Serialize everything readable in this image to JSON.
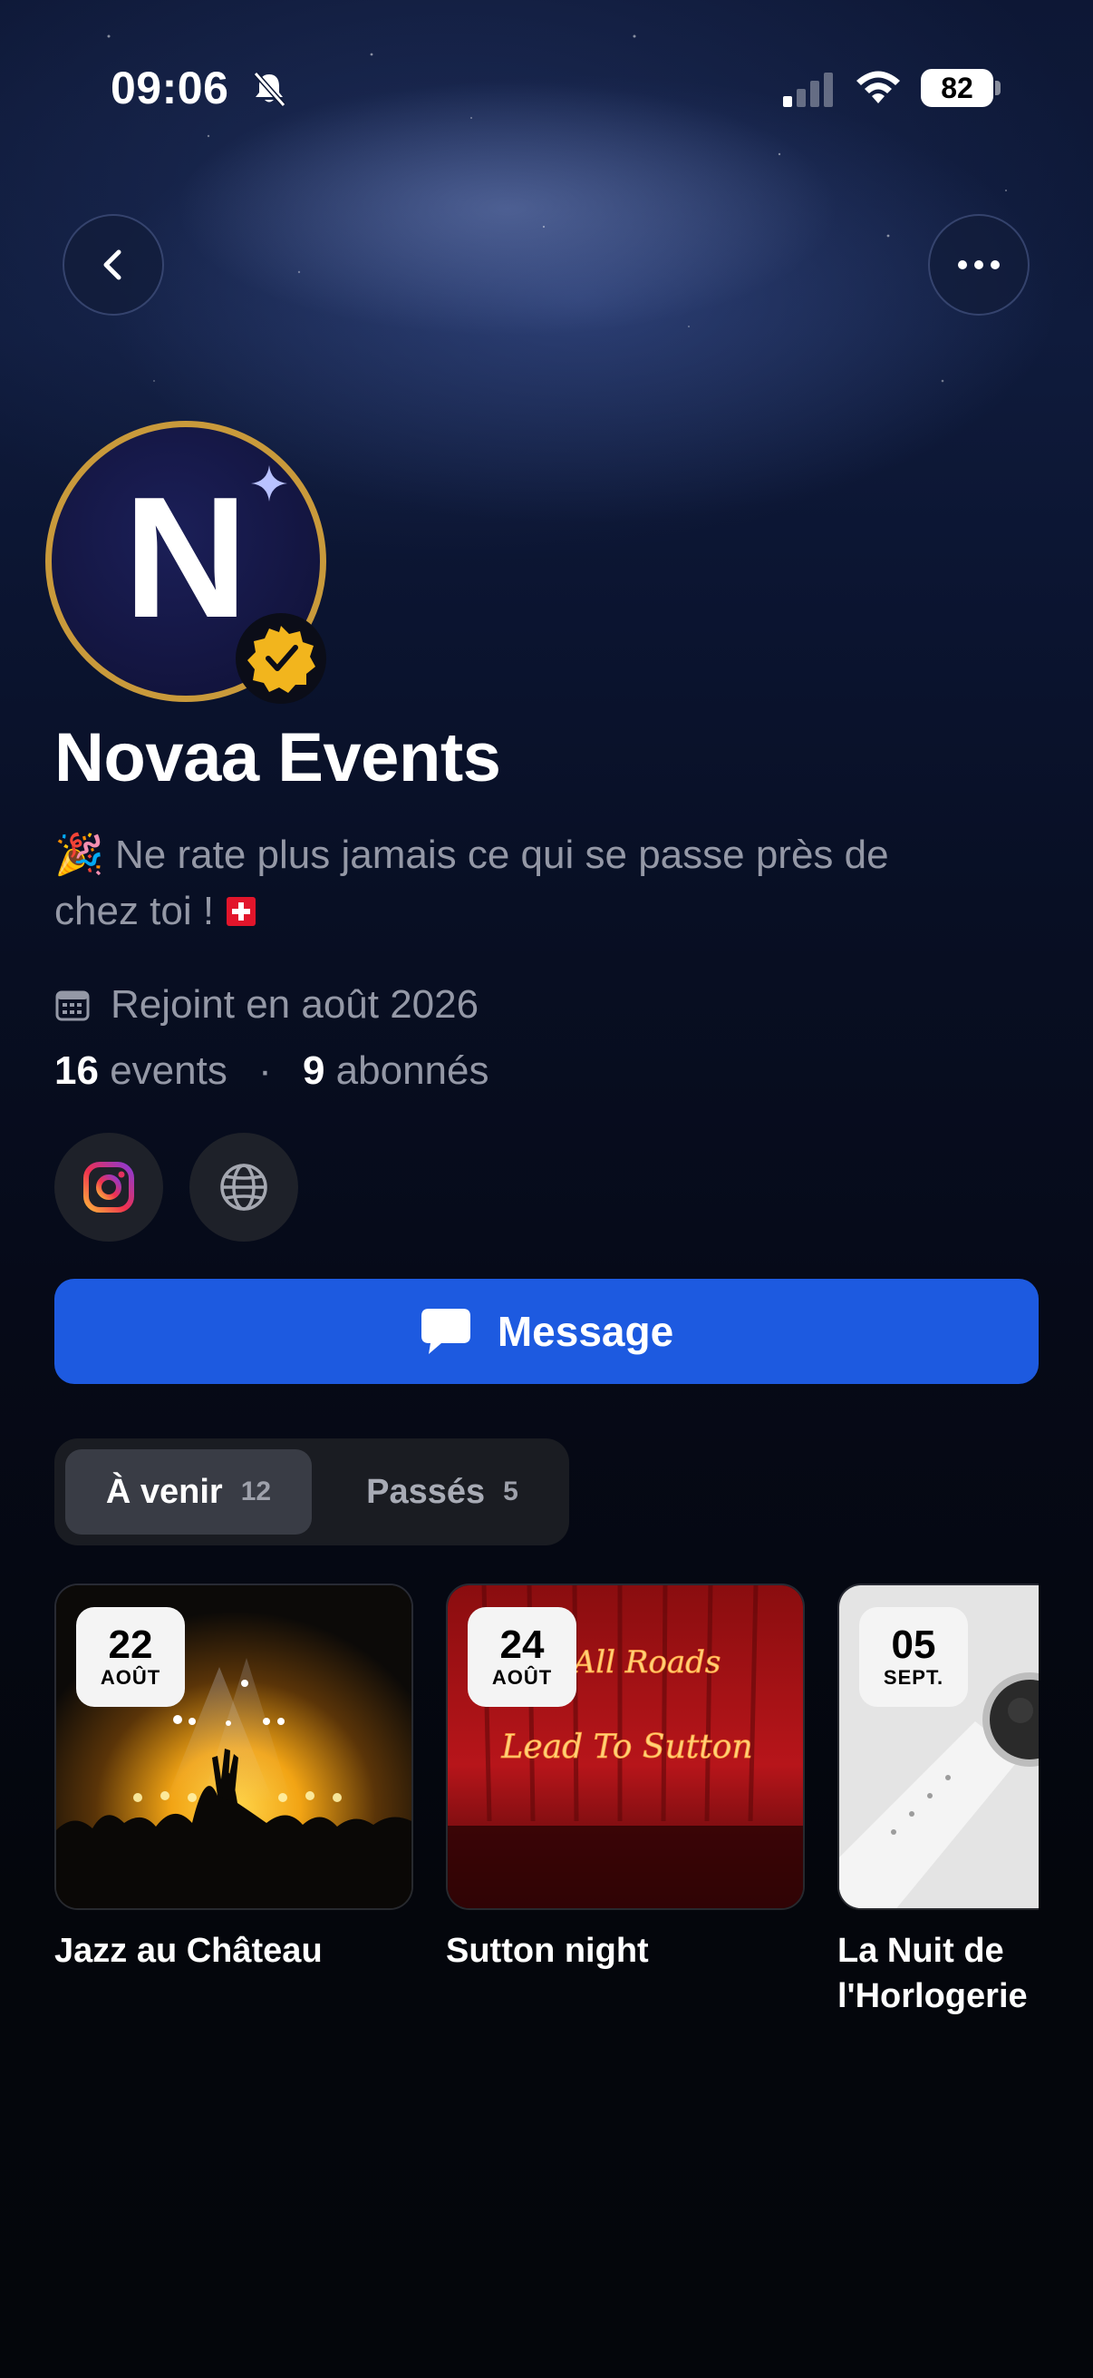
{
  "status_bar": {
    "time": "09:06",
    "battery": "82"
  },
  "header": {
    "back_icon": "chevron-left-icon",
    "more_icon": "ellipsis-icon"
  },
  "profile": {
    "avatar_letter": "N",
    "verified_icon": "verified-badge-icon",
    "name": "Novaa Events",
    "bio_emoji": "🎉",
    "bio": "Ne rate plus jamais ce qui se passe près de chez toi !",
    "bio_flag": "swiss-flag",
    "joined": "Rejoint en août 2026",
    "events_count": "16",
    "events_label": "events",
    "stats_separator": "·",
    "followers_count": "9",
    "followers_label": "abonnés"
  },
  "social_links": [
    {
      "icon": "instagram-icon"
    },
    {
      "icon": "globe-icon"
    }
  ],
  "message_button": {
    "label": "Message",
    "icon": "chat-bubble-icon"
  },
  "tabs": [
    {
      "label": "À venir",
      "count": "12",
      "active": true
    },
    {
      "label": "Passés",
      "count": "5",
      "active": false
    }
  ],
  "events": [
    {
      "day": "22",
      "month": "AOÛT",
      "title": "Jazz au Château"
    },
    {
      "day": "24",
      "month": "AOÛT",
      "title": "Sutton night",
      "image_text_1": "All Roads",
      "image_text_2": "Lead To Sutton"
    },
    {
      "day": "05",
      "month": "SEPT.",
      "title_line1": "La Nuit de",
      "title_line2": "l'Horlogerie"
    }
  ],
  "colors": {
    "accent_blue": "#1d5ae0",
    "avatar_ring_gold": "#c99a3b",
    "verified_yellow": "#f2b51d",
    "muted_text": "#9498a6"
  }
}
